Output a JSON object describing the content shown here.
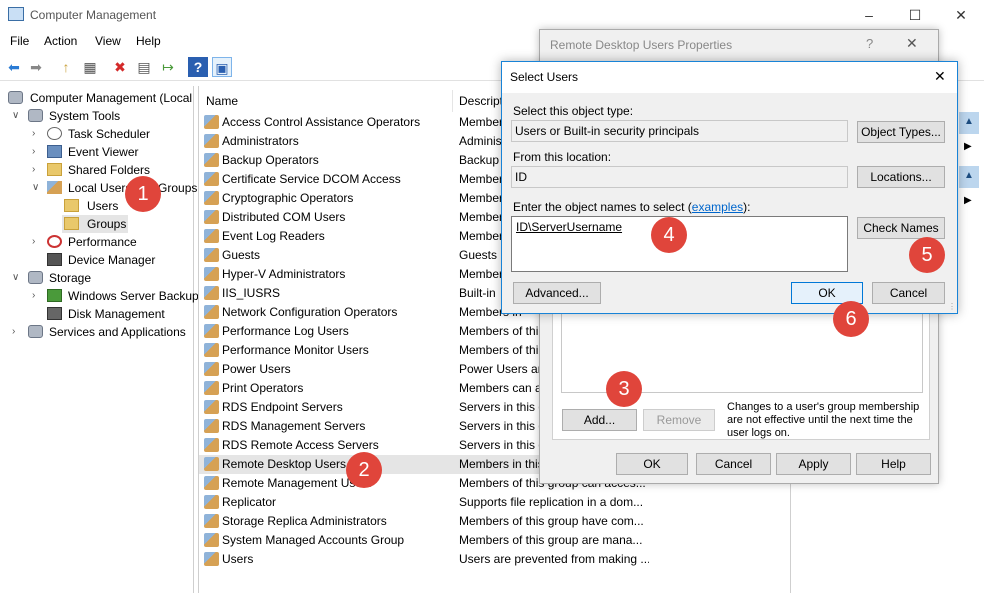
{
  "window": {
    "title": "Computer Management",
    "minimize": "–",
    "maximize": "☐",
    "close": "✕"
  },
  "menu": [
    "File",
    "Action",
    "View",
    "Help"
  ],
  "toolbar": {
    "back": "⬅",
    "forward": "➡",
    "up": "↑",
    "show_hide": "▦",
    "delete": "✖",
    "properties": "▤",
    "export": "↦",
    "help": "?",
    "show_action": "▣"
  },
  "tree": {
    "root": "Computer Management (Local",
    "system_tools": "System Tools",
    "task_scheduler": "Task Scheduler",
    "event_viewer": "Event Viewer",
    "shared_folders": "Shared Folders",
    "local_users_groups": "Local Users and Groups",
    "users": "Users",
    "groups": "Groups",
    "performance": "Performance",
    "device_manager": "Device Manager",
    "storage": "Storage",
    "wsb": "Windows Server Backup",
    "disk_management": "Disk Management",
    "services_apps": "Services and Applications"
  },
  "list": {
    "col_name": "Name",
    "col_desc": "Descripti",
    "rows": [
      {
        "name": "Access Control Assistance Operators",
        "desc": "Member"
      },
      {
        "name": "Administrators",
        "desc": "Adminis"
      },
      {
        "name": "Backup Operators",
        "desc": "Backup"
      },
      {
        "name": "Certificate Service DCOM Access",
        "desc": "Member"
      },
      {
        "name": "Cryptographic Operators",
        "desc": "Member"
      },
      {
        "name": "Distributed COM Users",
        "desc": "Member"
      },
      {
        "name": "Event Log Readers",
        "desc": "Member"
      },
      {
        "name": "Guests",
        "desc": "Guests h"
      },
      {
        "name": "Hyper-V Administrators",
        "desc": "Member"
      },
      {
        "name": "IIS_IUSRS",
        "desc": "Built-in"
      },
      {
        "name": "Network Configuration Operators",
        "desc": "Members in"
      },
      {
        "name": "Performance Log Users",
        "desc": "Members of thi"
      },
      {
        "name": "Performance Monitor Users",
        "desc": "Members of thi"
      },
      {
        "name": "Power Users",
        "desc": "Power Users are"
      },
      {
        "name": "Print Operators",
        "desc": "Members can a"
      },
      {
        "name": "RDS Endpoint Servers",
        "desc": "Servers in this g"
      },
      {
        "name": "RDS Management Servers",
        "desc": "Servers in this g"
      },
      {
        "name": "RDS Remote Access Servers",
        "desc": "Servers in this g"
      },
      {
        "name": "Remote Desktop Users",
        "desc": "Members in this"
      },
      {
        "name": "Remote Management Users",
        "desc": "Members of this group can acces..."
      },
      {
        "name": "Replicator",
        "desc": "Supports file replication in a dom..."
      },
      {
        "name": "Storage Replica Administrators",
        "desc": "Members of this group have com..."
      },
      {
        "name": "System Managed Accounts Group",
        "desc": "Members of this group are mana..."
      },
      {
        "name": "Users",
        "desc": "Users are prevented from making ..."
      }
    ]
  },
  "props": {
    "title": "Remote Desktop Users Properties",
    "help": "?",
    "close": "✕",
    "add": "Add...",
    "remove": "Remove",
    "note": "Changes to a user's group membership are not effective until the next time the user logs on.",
    "ok": "OK",
    "cancel": "Cancel",
    "apply": "Apply",
    "helpbtn": "Help"
  },
  "select": {
    "title": "Select Users",
    "close": "✕",
    "type_label": "Select this object type:",
    "type_value": "Users or Built-in security principals",
    "object_types": "Object Types...",
    "loc_label": "From this location:",
    "loc_value": "ID",
    "locations": "Locations...",
    "names_label_pre": "Enter the object names to select (",
    "names_link": "examples",
    "names_label_post": "):",
    "names_value": "ID\\ServerUsername",
    "check_names": "Check Names",
    "advanced": "Advanced...",
    "ok": "OK",
    "cancel": "Cancel"
  },
  "badges": [
    "1",
    "2",
    "3",
    "4",
    "5",
    "6"
  ],
  "colors": {
    "badge": "#e0453b",
    "accent": "#1883d7",
    "link": "#0066cc"
  }
}
